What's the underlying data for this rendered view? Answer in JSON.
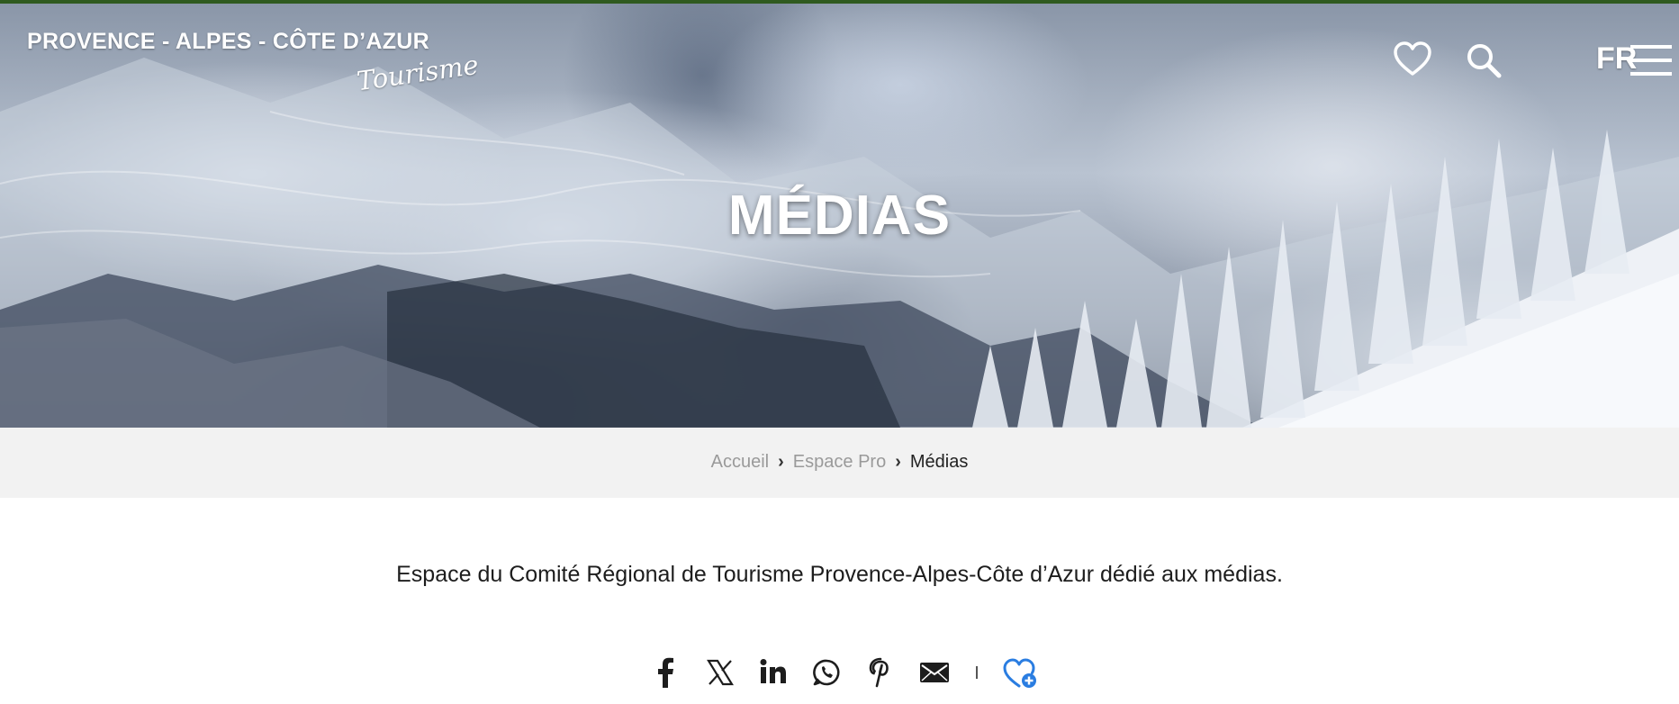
{
  "header": {
    "logo_line1": "PROVENCE - ALPES - CÔTE D’AZUR",
    "logo_line2": "Tourisme",
    "language": "FR",
    "icons": [
      "heart-icon",
      "search-icon",
      "menu-icon"
    ]
  },
  "hero": {
    "title": "MÉDIAS"
  },
  "breadcrumb": {
    "items": [
      "Accueil",
      "Espace Pro",
      "Médias"
    ],
    "separator": "›"
  },
  "intro": {
    "text": "Espace du Comité Régional de Tourisme Provence-Alpes-Côte d’Azur dédié aux médias."
  },
  "share": {
    "icons": [
      "facebook-icon",
      "x-icon",
      "linkedin-icon",
      "whatsapp-icon",
      "pinterest-icon",
      "email-icon",
      "favorite-add-icon"
    ],
    "favorite_color": "#2a7de1"
  },
  "colors": {
    "topbar": "#2f5a1f",
    "breadcrumb_bg": "#f2f2f2"
  }
}
